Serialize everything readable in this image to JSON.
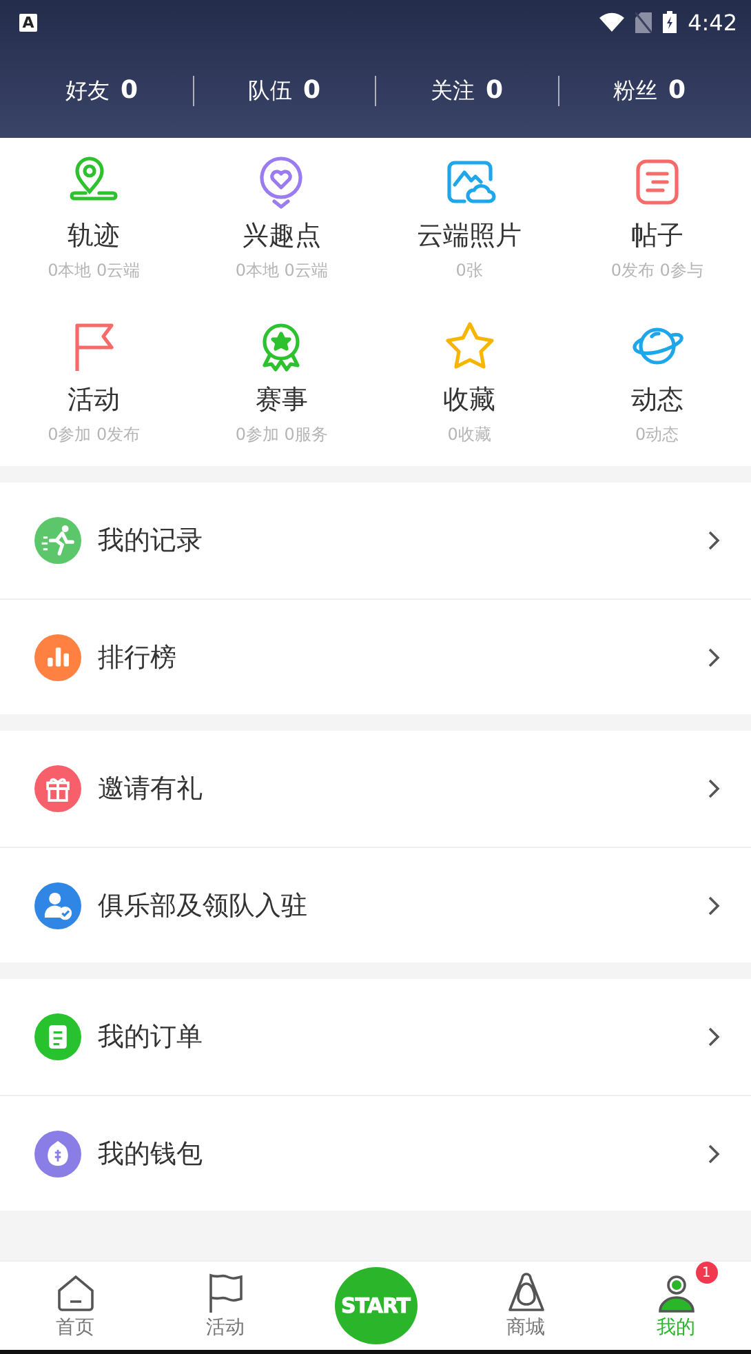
{
  "status_bar": {
    "app_letter": "A",
    "time": "4:42"
  },
  "stats": [
    {
      "label": "好友",
      "value": "0"
    },
    {
      "label": "队伍",
      "value": "0"
    },
    {
      "label": "关注",
      "value": "0"
    },
    {
      "label": "粉丝",
      "value": "0"
    }
  ],
  "features": [
    {
      "kind": "route",
      "title": "轨迹",
      "sub": "0本地 0云端"
    },
    {
      "kind": "poi",
      "title": "兴趣点",
      "sub": "0本地 0云端"
    },
    {
      "kind": "cloud-photo",
      "title": "云端照片",
      "sub": "0张"
    },
    {
      "kind": "post",
      "title": "帖子",
      "sub": "0发布 0参与"
    },
    {
      "kind": "flag",
      "title": "活动",
      "sub": "0参加 0发布"
    },
    {
      "kind": "medal",
      "title": "赛事",
      "sub": "0参加 0服务"
    },
    {
      "kind": "star",
      "title": "收藏",
      "sub": "0收藏"
    },
    {
      "kind": "planet",
      "title": "动态",
      "sub": "0动态"
    }
  ],
  "menu_groups": [
    [
      {
        "kind": "runner",
        "label": "我的记录",
        "color": "#5cc76a"
      },
      {
        "kind": "chart",
        "label": "排行榜",
        "color": "#ff8142"
      }
    ],
    [
      {
        "kind": "gift",
        "label": "邀请有礼",
        "color": "#f7606a"
      },
      {
        "kind": "club",
        "label": "俱乐部及领队入驻",
        "color": "#2f86e4"
      }
    ],
    [
      {
        "kind": "order",
        "label": "我的订单",
        "color": "#27c22e"
      },
      {
        "kind": "wallet",
        "label": "我的钱包",
        "color": "#8a7ee6"
      }
    ]
  ],
  "tabs": [
    {
      "kind": "home",
      "label": "首页",
      "selected": false
    },
    {
      "kind": "flag",
      "label": "活动",
      "selected": false
    },
    {
      "kind": "start",
      "logo_text": "START",
      "selected": false
    },
    {
      "kind": "store",
      "label": "商城",
      "selected": false
    },
    {
      "kind": "person",
      "label": "我的",
      "selected": true,
      "badge": "1"
    }
  ]
}
